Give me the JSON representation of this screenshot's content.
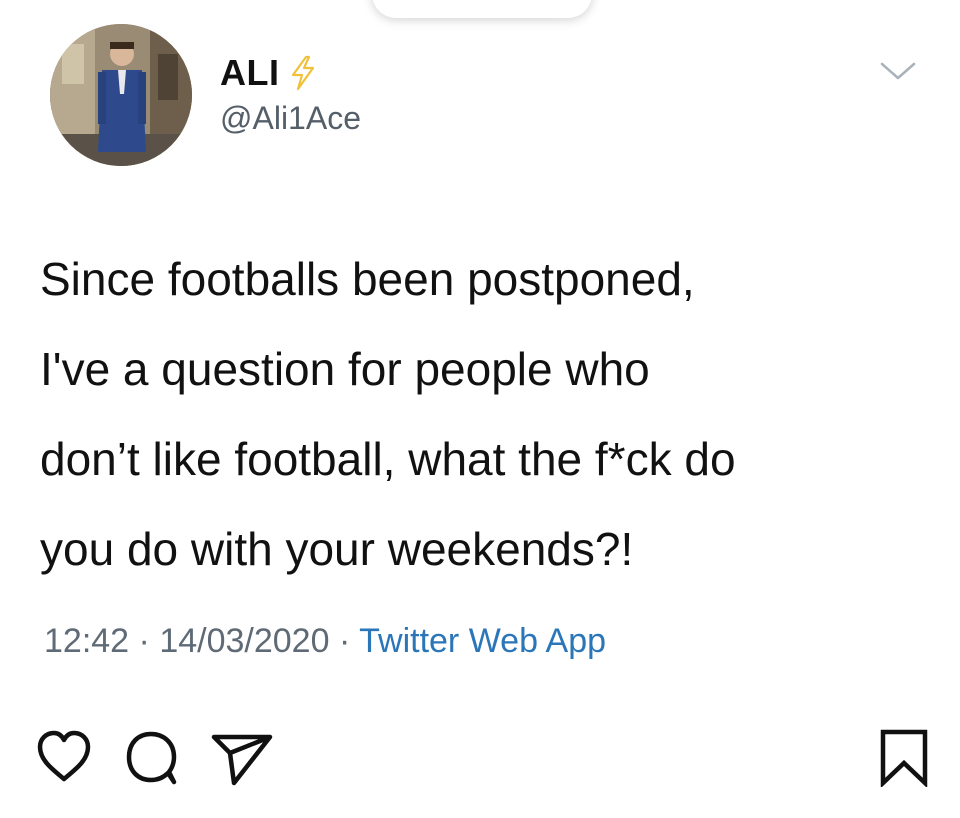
{
  "user": {
    "name": "ALI",
    "handle": "@Ali1Ace",
    "avatar": "profile-photo"
  },
  "tweet": {
    "text": "Since footballs been postponed,\nI've a question for people who\ndon’t like football, what the f*ck do\nyou do with your weekends?!",
    "time": "12:42",
    "date": "14/03/2020",
    "separator": "·",
    "source": "Twitter Web App"
  },
  "icons": {
    "badge": "lightning-bolt-icon",
    "menu": "chevron-down-icon",
    "like": "heart-icon",
    "comment": "comment-icon",
    "share": "paper-plane-icon",
    "save": "bookmark-icon"
  },
  "colors": {
    "text": "#111111",
    "handle": "#555f69",
    "meta": "#5e6a75",
    "source_link": "#2a76b8",
    "bolt": "#f0c23a"
  }
}
